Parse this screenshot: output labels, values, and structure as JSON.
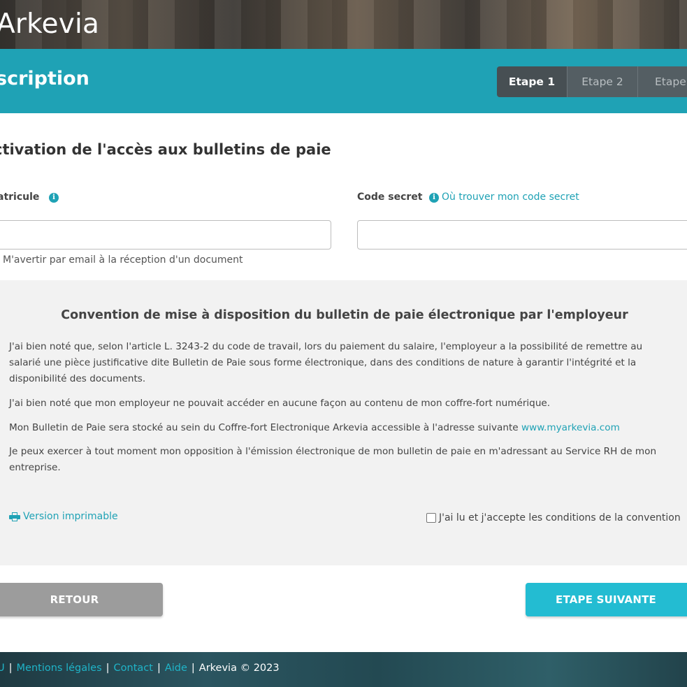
{
  "header": {
    "logo": "Arkevia",
    "page_title": "scription"
  },
  "steps": [
    {
      "label": "Etape 1",
      "active": true
    },
    {
      "label": "Etape 2",
      "active": false
    },
    {
      "label": "Etape",
      "active": false
    }
  ],
  "form": {
    "section_title": "ctivation de l'accès aux bulletins de paie",
    "matricule_label": "atricule",
    "matricule_value": "",
    "code_label": "Code secret",
    "code_help": "Où trouver mon code secret",
    "code_value": "",
    "notify_label": "M'avertir par email à la réception d'un document"
  },
  "convention": {
    "title": "Convention de mise à disposition du bulletin de paie électronique par l'employeur",
    "p1": "J'ai bien noté que, selon l'article L. 3243-2 du code de travail, lors du paiement du salaire, l'employeur a la possibilité de remettre au salarié une pièce justificative dite Bulletin de Paie sous forme électronique, dans des conditions de nature à garantir l'intégrité et la disponibilité des documents.",
    "p2": "J'ai bien noté que mon employeur ne pouvait accéder en aucune façon au contenu de mon coffre-fort numérique.",
    "p3": "Mon Bulletin de Paie sera stocké au sein du Coffre-fort Electronique Arkevia accessible à l'adresse suivante ",
    "p3_link": "www.myarkevia.com",
    "p4": "Je peux exercer à tout moment mon opposition à l'émission électronique de mon bulletin de paie en m'adressant au Service RH de mon entreprise.",
    "print_label": "Version imprimable",
    "accept_label": "J'ai lu et j'accepte les conditions de la convention"
  },
  "buttons": {
    "back": "RETOUR",
    "next": "ETAPE SUIVANTE"
  },
  "footer": {
    "cgu": "U",
    "legal": "Mentions légales",
    "contact": "Contact",
    "help": "Aide",
    "copyright": "Arkevia © 2023"
  },
  "colors": {
    "accent": "#1fa2b5",
    "button_next": "#23bcd2",
    "button_back": "#9c9c9c"
  }
}
